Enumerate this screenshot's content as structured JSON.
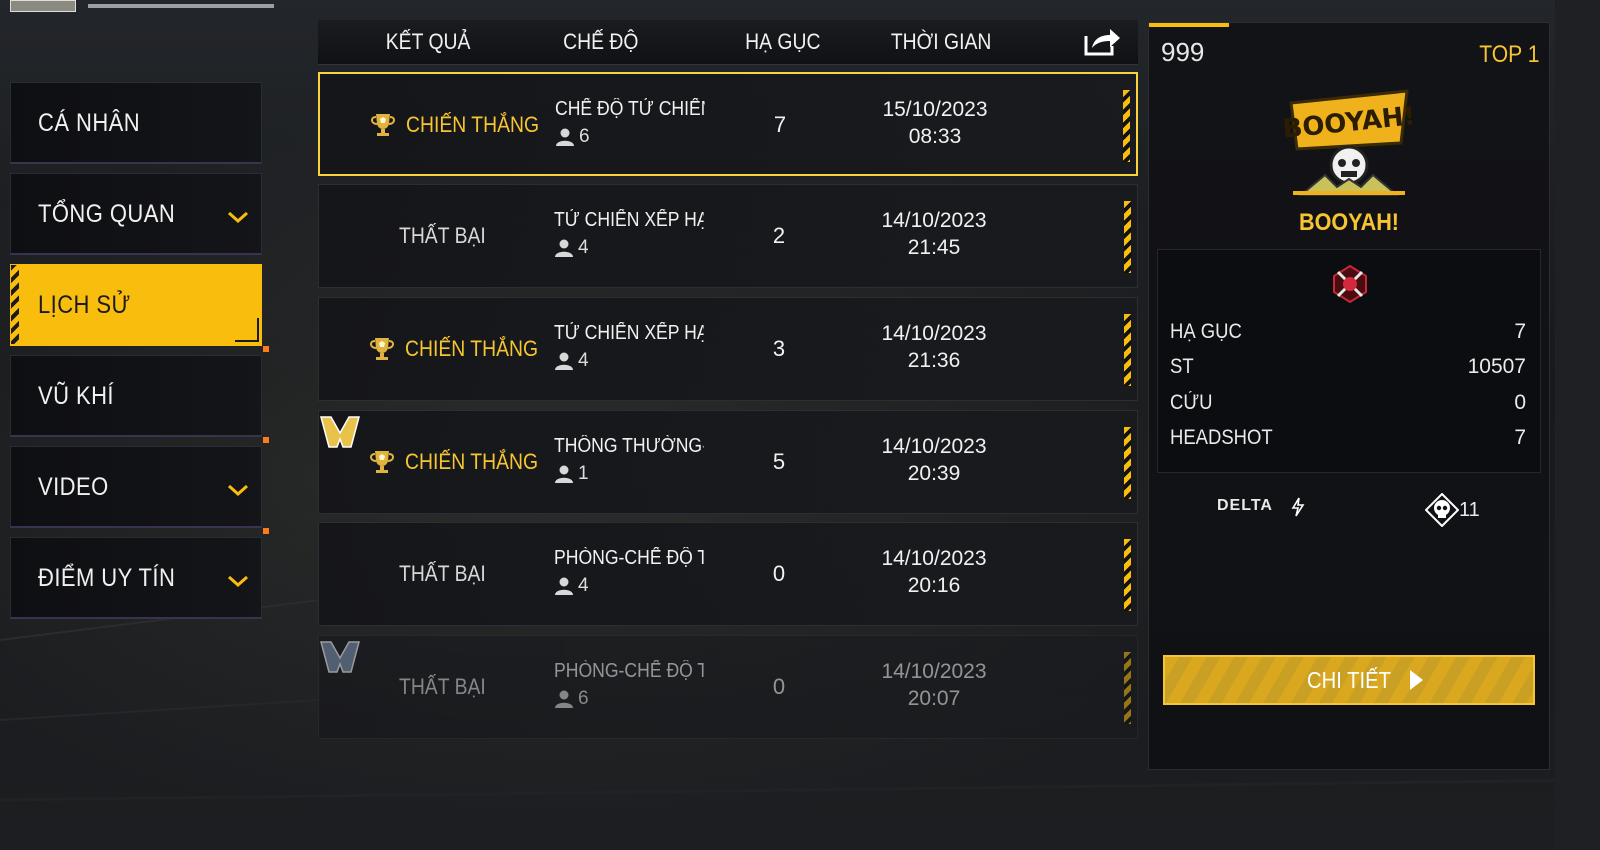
{
  "sidebar": {
    "items": [
      {
        "label": "CÁ NHÂN",
        "active": false,
        "chevron": false,
        "dot": false
      },
      {
        "label": "TỔNG QUAN",
        "active": false,
        "chevron": true,
        "dot": false
      },
      {
        "label": "LỊCH SỬ",
        "active": true,
        "chevron": false,
        "dot": false
      },
      {
        "label": "VŨ KHÍ",
        "active": false,
        "chevron": false,
        "dot": true
      },
      {
        "label": "VIDEO",
        "active": false,
        "chevron": true,
        "dot": true
      },
      {
        "label": "ĐIỂM UY TÍN",
        "active": false,
        "chevron": true,
        "dot": true
      }
    ]
  },
  "table": {
    "headers": {
      "result": "KẾT QUẢ",
      "mode": "CHẾ ĐỘ",
      "kills": "HẠ GỤC",
      "time": "THỜI GIAN"
    },
    "share_icon": "share-icon",
    "rows": [
      {
        "result": "CHIẾN THẮNG",
        "win": true,
        "mode": "CHẾ ĐỘ TỬ CHIẾN",
        "players": "6",
        "kills": "7",
        "date": "15/10/2023",
        "clock": "08:33",
        "selected": true,
        "mvp": false,
        "faded": false
      },
      {
        "result": "THẤT BẠI",
        "win": false,
        "mode": "TỬ CHIẾN XẾP HẠ",
        "players": "4",
        "kills": "2",
        "date": "14/10/2023",
        "clock": "21:45",
        "selected": false,
        "mvp": false,
        "faded": false
      },
      {
        "result": "CHIẾN THẮNG",
        "win": true,
        "mode": "TỬ CHIẾN XẾP HẠ",
        "players": "4",
        "kills": "3",
        "date": "14/10/2023",
        "clock": "21:36",
        "selected": false,
        "mvp": false,
        "faded": false
      },
      {
        "result": "CHIẾN THẮNG",
        "win": true,
        "mode": "THÔNG THƯỜNG-I",
        "players": "1",
        "kills": "5",
        "date": "14/10/2023",
        "clock": "20:39",
        "selected": false,
        "mvp": true,
        "faded": false
      },
      {
        "result": "THẤT BẠI",
        "win": false,
        "mode": "PHÒNG-CHẾ ĐỘ T",
        "players": "4",
        "kills": "0",
        "date": "14/10/2023",
        "clock": "20:16",
        "selected": false,
        "mvp": false,
        "faded": false
      },
      {
        "result": "THẤT BẠI",
        "win": false,
        "mode": "PHÒNG-CHẾ ĐỘ T",
        "players": "6",
        "kills": "0",
        "date": "14/10/2023",
        "clock": "20:07",
        "selected": false,
        "mvp": true,
        "faded": true
      }
    ]
  },
  "detail": {
    "score": "999",
    "rank": "TOP 1",
    "booyah": "BOOYAH!",
    "stats": [
      {
        "label": "HẠ GỤC",
        "value": "7"
      },
      {
        "label": "ST",
        "value": "10507"
      },
      {
        "label": "CỨU",
        "value": "0"
      },
      {
        "label": "HEADSHOT",
        "value": "7"
      }
    ],
    "weapon": "DELTA",
    "skull_count": "11",
    "button": "CHI TIẾT"
  },
  "colors": {
    "accent": "#f9bd0e",
    "win": "#f7c531"
  }
}
